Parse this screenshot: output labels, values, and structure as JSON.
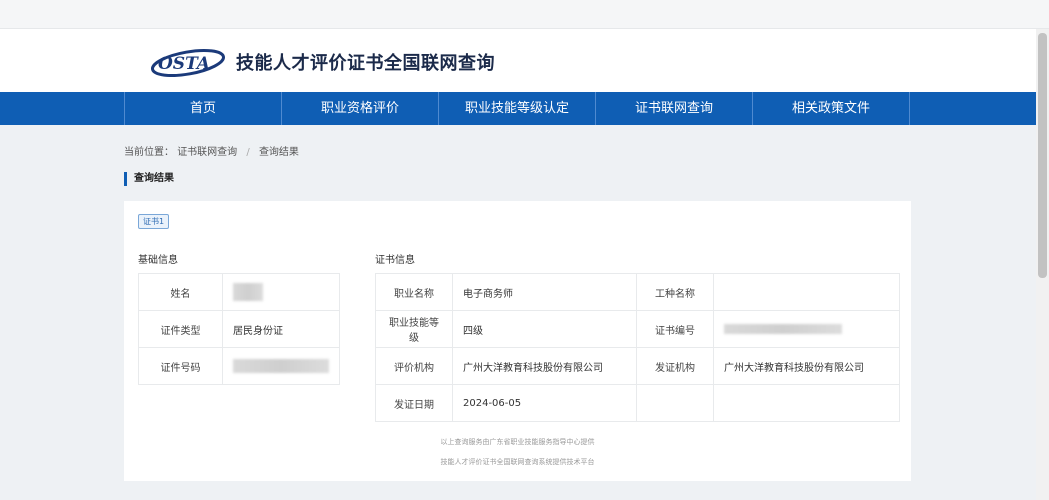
{
  "header": {
    "logo_text": "OSTA",
    "title": "技能人才评价证书全国联网查询"
  },
  "nav": {
    "items": [
      "首页",
      "职业资格评价",
      "职业技能等级认定",
      "证书联网查询",
      "相关政策文件"
    ]
  },
  "breadcrumb": {
    "prefix": "当前位置：",
    "items": [
      "证书联网查询",
      "查询结果"
    ],
    "separator": "/"
  },
  "section_title": "查询结果",
  "result": {
    "tag": "证书1",
    "basic_label": "基础信息",
    "cert_label": "证书信息",
    "basic": [
      {
        "key": "姓名",
        "value": ""
      },
      {
        "key": "证件类型",
        "value": "居民身份证"
      },
      {
        "key": "证件号码",
        "value": ""
      }
    ],
    "cert": {
      "occupation_name_key": "职业名称",
      "occupation_name": "电子商务师",
      "work_type_key": "工种名称",
      "work_type": "",
      "level_key": "职业技能等级",
      "level": "四级",
      "cert_no_key": "证书编号",
      "cert_no": "",
      "eval_org_key": "评价机构",
      "eval_org": "广州大洋教育科技股份有限公司",
      "issue_org_key": "发证机构",
      "issue_org": "广州大洋教育科技股份有限公司",
      "issue_date_key": "发证日期",
      "issue_date": "2024-06-05"
    },
    "footer1": "以上查询服务由广东省职业技能服务指导中心提供",
    "footer2": "技能人才评价证书全国联网查询系统提供技术平台"
  },
  "colors": {
    "nav_bg": "#0f5eb4",
    "accent": "#0f5eb4",
    "page_bg": "#eef1f4"
  }
}
